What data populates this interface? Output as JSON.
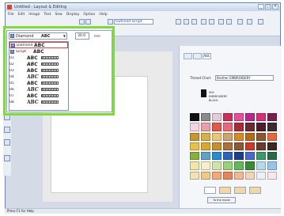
{
  "window": {
    "title": "Untitled - Layout & Editing"
  },
  "menubar": {
    "items": [
      "File",
      "Edit",
      "Image",
      "Text",
      "Sew",
      "Display",
      "Option",
      "Help"
    ]
  },
  "toolbar": {
    "font_field": "Outlined Script"
  },
  "panel": {
    "tabs": [
      "",
      "",
      "ABC"
    ],
    "thread_chart_label": "Thread Chart",
    "thread_chart_value": "Brother EMBROIDERY",
    "current_color_code": "900",
    "current_color_brand": "EMBROIDERY",
    "current_color_name": "BLACK",
    "palette_colors": [
      "#111111",
      "#8a8a8a",
      "#e8c9d6",
      "#c8325a",
      "#e84f9a",
      "#b42a8c",
      "#d82f7a",
      "#7a1e4e",
      "#f4d6e0",
      "#e8a0a8",
      "#e0584a",
      "#e86a7a",
      "#a82c38",
      "#6a2a36",
      "#4a1e2a",
      "#3a2a32",
      "#c8962e",
      "#d4b24a",
      "#e8c878",
      "#c8a66a",
      "#d48a2a",
      "#b46c1c",
      "#8a5a2c",
      "#e46a3c",
      "#e6c24c",
      "#d8a830",
      "#c48f2c",
      "#a8723a",
      "#8a5a36",
      "#c83a2a",
      "#6a3a2a",
      "#3a2a22",
      "#88b03a",
      "#62a2c8",
      "#2a8ad4",
      "#2e62b8",
      "#1e3e8a",
      "#4a6acb",
      "#3a9a6a",
      "#2a6a4a",
      "#f0e6a8",
      "#f4f0cc",
      "#cfe4a8",
      "#9ad07a",
      "#62b85a",
      "#3a8a3a",
      "#b8d8e8",
      "#98c4ea",
      "#f4e2b0",
      "#f0c888",
      "#f4a878",
      "#e8845a",
      "#f0b890",
      "#f2d4b8",
      "#eef0f2",
      "#f6e8ea"
    ],
    "to_mode_button": "To the mode"
  },
  "font_picker": {
    "current_name": "Diamond",
    "current_sample": "ABC",
    "size_value": "30.0",
    "size_unit": "mm",
    "items": [
      {
        "name": "Diamond",
        "sample": "ABC",
        "selected": true
      },
      {
        "name": "Script",
        "sample": "ABC"
      },
      {
        "name": "01",
        "sample": "ABC"
      },
      {
        "name": "02",
        "sample": "ABC"
      },
      {
        "name": "03",
        "sample": "ABC"
      },
      {
        "name": "04",
        "sample": "ABC"
      },
      {
        "name": "05",
        "sample": "ABC"
      },
      {
        "name": "06",
        "sample": "ABC"
      },
      {
        "name": "07",
        "sample": "ABC"
      },
      {
        "name": "08",
        "sample": "ABC"
      }
    ]
  },
  "statusbar": {
    "text": "Press F1 for Help"
  },
  "colors": {
    "highlight": "#7ddc3a",
    "accent": "#3a62b5"
  }
}
